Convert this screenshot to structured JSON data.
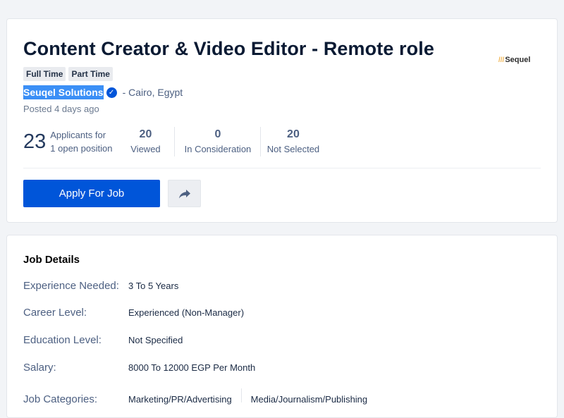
{
  "header": {
    "job_title": "Content Creator & Video Editor - Remote role",
    "logo_text": "Sequel",
    "tags": [
      "Full Time",
      "Part Time"
    ],
    "company_name": "Seuqel Solutions",
    "location": "- Cairo, Egypt",
    "posted": "Posted 4 days ago",
    "stats": {
      "applicants_count": "23",
      "applicants_label_1": "Applicants for",
      "applicants_label_2": "1 open position",
      "viewed_count": "20",
      "viewed_label": "Viewed",
      "consideration_count": "0",
      "consideration_label": "In Consideration",
      "not_selected_count": "20",
      "not_selected_label": "Not Selected"
    },
    "apply_label": "Apply For Job"
  },
  "details": {
    "title": "Job Details",
    "rows": [
      {
        "label": "Experience Needed:",
        "value": "3 To 5 Years"
      },
      {
        "label": "Career Level:",
        "value": "Experienced (Non-Manager)"
      },
      {
        "label": "Education Level:",
        "value": "Not Specified"
      },
      {
        "label": "Salary:",
        "value": "8000 To 12000 EGP Per Month"
      },
      {
        "label": "Job Categories:",
        "values": [
          "Marketing/PR/Advertising",
          "Media/Journalism/Publishing"
        ]
      }
    ]
  }
}
